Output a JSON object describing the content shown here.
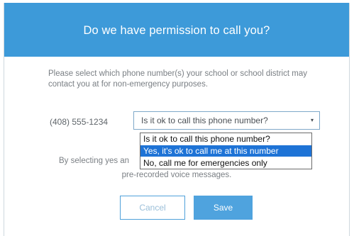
{
  "dialog": {
    "title": "Do we have permission to call you?",
    "description": "Please select which phone number(s) your school or school district may contact you at for non-emergency purposes.",
    "phone_number": "(408) 555-1234",
    "select": {
      "value": "Is it ok to call this phone number?",
      "caret": "▾",
      "options": [
        {
          "label": "Is it ok to call this phone number?",
          "selected": false
        },
        {
          "label": "Yes, it's ok to call me at this number",
          "selected": true
        },
        {
          "label": "No, call me for emergencies only",
          "selected": false
        }
      ]
    },
    "consent_line_1": "By selecting yes an",
    "consent_line_2": "pre-recorded voice messages.",
    "cancel_label": "Cancel",
    "save_label": "Save"
  },
  "colors": {
    "header": "#3d9ad9",
    "primary_button": "#4fa3de",
    "highlight": "#1e73d6"
  }
}
